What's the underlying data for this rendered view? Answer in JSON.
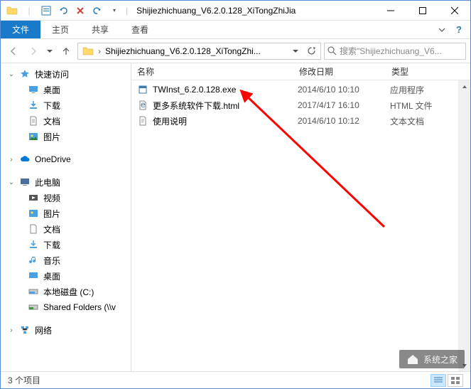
{
  "window": {
    "title": "Shijiezhichuang_V6.2.0.128_XiTongZhiJia"
  },
  "ribbon": {
    "file_tab": "文件",
    "tabs": [
      "主页",
      "共享",
      "查看"
    ]
  },
  "nav": {
    "breadcrumb": "Shijiezhichuang_V6.2.0.128_XiTongZhi...",
    "search_placeholder": "搜索\"Shijiezhichuang_V6..."
  },
  "sidebar": {
    "quick_access": "快速访问",
    "quick_items": [
      {
        "label": "桌面",
        "icon": "desktop"
      },
      {
        "label": "下载",
        "icon": "download"
      },
      {
        "label": "文档",
        "icon": "document"
      },
      {
        "label": "图片",
        "icon": "pictures"
      }
    ],
    "onedrive": "OneDrive",
    "this_pc": "此电脑",
    "pc_items": [
      {
        "label": "视频",
        "icon": "video"
      },
      {
        "label": "图片",
        "icon": "pictures"
      },
      {
        "label": "文档",
        "icon": "document"
      },
      {
        "label": "下载",
        "icon": "download"
      },
      {
        "label": "音乐",
        "icon": "music"
      },
      {
        "label": "桌面",
        "icon": "desktop"
      },
      {
        "label": "本地磁盘 (C:)",
        "icon": "disk"
      },
      {
        "label": "Shared Folders (\\\\v",
        "icon": "netdrive"
      }
    ],
    "network": "网络"
  },
  "columns": {
    "name": "名称",
    "date": "修改日期",
    "type": "类型"
  },
  "files": [
    {
      "name": "TWInst_6.2.0.128.exe",
      "date": "2014/6/10 10:10",
      "type": "应用程序",
      "icon": "exe"
    },
    {
      "name": "更多系统软件下载.html",
      "date": "2017/4/17 16:10",
      "type": "HTML 文件",
      "icon": "html"
    },
    {
      "name": "使用说明",
      "date": "2014/6/10 10:12",
      "type": "文本文档",
      "icon": "txt"
    }
  ],
  "status": {
    "item_count": "3 个项目"
  },
  "watermark": "系统之家"
}
